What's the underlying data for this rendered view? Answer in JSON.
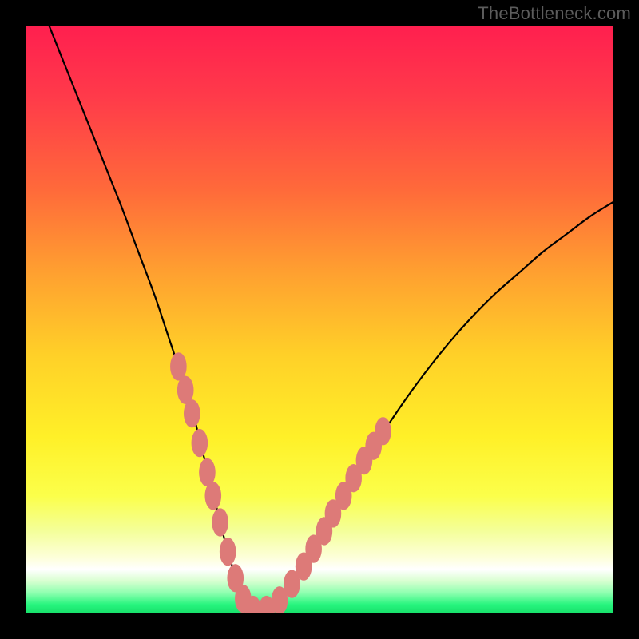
{
  "watermark": "TheBottleneck.com",
  "colors": {
    "frame": "#000000",
    "watermark": "#5c5c5c",
    "curve": "#000000",
    "marker": "#dd7a78",
    "gradient_stops": [
      {
        "offset": 0.0,
        "color": "#ff1f4f"
      },
      {
        "offset": 0.12,
        "color": "#ff3a4a"
      },
      {
        "offset": 0.28,
        "color": "#ff6a3a"
      },
      {
        "offset": 0.42,
        "color": "#ffa030"
      },
      {
        "offset": 0.56,
        "color": "#ffd028"
      },
      {
        "offset": 0.7,
        "color": "#fff028"
      },
      {
        "offset": 0.8,
        "color": "#fbff4a"
      },
      {
        "offset": 0.86,
        "color": "#f4ff9a"
      },
      {
        "offset": 0.905,
        "color": "#fdffda"
      },
      {
        "offset": 0.925,
        "color": "#ffffff"
      },
      {
        "offset": 0.945,
        "color": "#d8ffd0"
      },
      {
        "offset": 0.965,
        "color": "#8fffb0"
      },
      {
        "offset": 0.985,
        "color": "#27f57e"
      },
      {
        "offset": 1.0,
        "color": "#17e06a"
      }
    ]
  },
  "chart_data": {
    "type": "line",
    "title": "",
    "xlabel": "",
    "ylabel": "",
    "xlim": [
      0,
      100
    ],
    "ylim": [
      0,
      100
    ],
    "grid": false,
    "legend": false,
    "series": [
      {
        "name": "bottleneck-curve",
        "x": [
          4,
          8,
          12,
          16,
          19,
          22,
          24,
          26,
          28,
          29.5,
          31,
          32.5,
          34,
          35.5,
          37,
          39,
          41,
          44,
          48,
          52,
          56,
          60,
          64,
          68,
          72,
          76,
          80,
          84,
          88,
          92,
          96,
          100
        ],
        "y": [
          100,
          90,
          80,
          70,
          62,
          54,
          48,
          42,
          36,
          30,
          24,
          18,
          12,
          7,
          3,
          0.5,
          0.5,
          3,
          9,
          16,
          23,
          29.5,
          35.5,
          41,
          46,
          50.5,
          54.5,
          58,
          61.5,
          64.5,
          67.5,
          70
        ]
      }
    ],
    "markers": {
      "name": "highlight-points",
      "points": [
        {
          "x": 26.0,
          "y": 42.0
        },
        {
          "x": 27.2,
          "y": 38.0
        },
        {
          "x": 28.3,
          "y": 34.0
        },
        {
          "x": 29.6,
          "y": 29.0
        },
        {
          "x": 30.9,
          "y": 24.0
        },
        {
          "x": 31.9,
          "y": 20.0
        },
        {
          "x": 33.1,
          "y": 15.5
        },
        {
          "x": 34.4,
          "y": 10.5
        },
        {
          "x": 35.7,
          "y": 6.0
        },
        {
          "x": 37.0,
          "y": 2.5
        },
        {
          "x": 38.7,
          "y": 0.6
        },
        {
          "x": 41.0,
          "y": 0.6
        },
        {
          "x": 43.2,
          "y": 2.2
        },
        {
          "x": 45.3,
          "y": 5.0
        },
        {
          "x": 47.3,
          "y": 8.0
        },
        {
          "x": 49.0,
          "y": 11.0
        },
        {
          "x": 50.8,
          "y": 14.0
        },
        {
          "x": 52.3,
          "y": 17.0
        },
        {
          "x": 54.1,
          "y": 20.0
        },
        {
          "x": 55.8,
          "y": 23.0
        },
        {
          "x": 57.6,
          "y": 26.0
        },
        {
          "x": 59.2,
          "y": 28.5
        },
        {
          "x": 60.8,
          "y": 31.0
        }
      ],
      "rx": 1.4,
      "ry": 2.4
    }
  }
}
